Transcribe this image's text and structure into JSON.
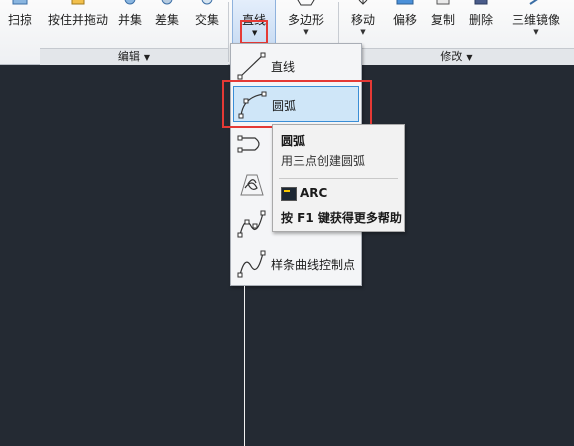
{
  "ribbon": {
    "tools": [
      {
        "id": "scan",
        "label": "扫掠"
      },
      {
        "id": "presspull",
        "label": "按住并拖动"
      },
      {
        "id": "union",
        "label": "并集"
      },
      {
        "id": "subtract",
        "label": "差集"
      },
      {
        "id": "intersect",
        "label": "交集"
      }
    ],
    "line_tool": {
      "label": "直线"
    },
    "polygon_tool": {
      "label": "多边形"
    },
    "modify_tools": [
      {
        "id": "move",
        "label": "移动"
      },
      {
        "id": "offset",
        "label": "偏移"
      },
      {
        "id": "copy",
        "label": "复制"
      },
      {
        "id": "erase",
        "label": "删除"
      },
      {
        "id": "mirror3d",
        "label": "三维镜像"
      }
    ],
    "panels": {
      "edit": "编辑",
      "modify": "修改"
    }
  },
  "menu": {
    "items": [
      {
        "id": "line",
        "label": "直线"
      },
      {
        "id": "arc",
        "label": "圆弧",
        "selected": true
      },
      {
        "id": "hidden1",
        "label": ""
      },
      {
        "id": "hidden2",
        "label": ""
      },
      {
        "id": "hidden3",
        "label": ""
      },
      {
        "id": "spline_cv",
        "label": "样条曲线控制点"
      }
    ]
  },
  "tooltip": {
    "title": "圆弧",
    "description": "用三点创建圆弧",
    "command": "ARC",
    "help": "按 F1 键获得更多帮助"
  },
  "colors": {
    "canvas": "#242a33",
    "highlight": "#e53935",
    "selection": "#cfe6f8"
  }
}
